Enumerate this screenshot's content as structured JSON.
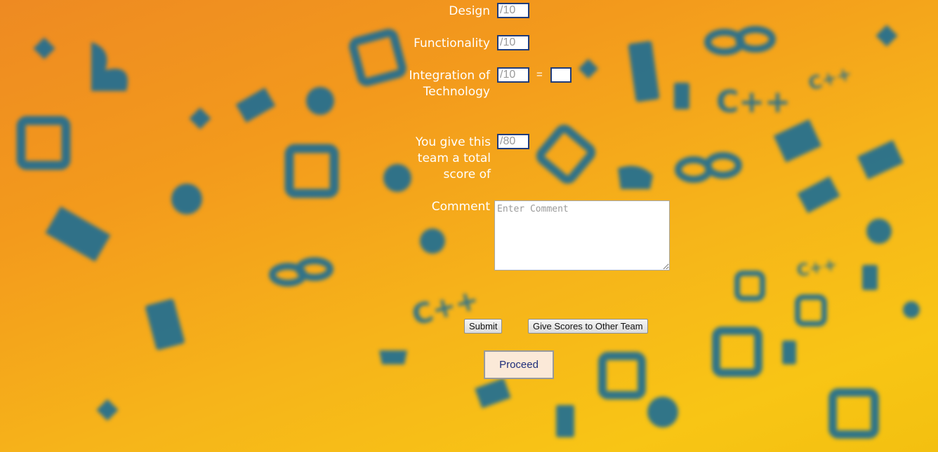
{
  "colors": {
    "accent_blue": "#1f3b7a",
    "pattern_blue": "#1a6c96",
    "bg_orange": "#f39a1c",
    "bg_yellow": "#f8c515"
  },
  "scores": {
    "design": {
      "label": "Design",
      "placeholder": "/10"
    },
    "functionality": {
      "label": "Functionality",
      "placeholder": "/10"
    },
    "integration": {
      "label_line1": "Integration of",
      "label_line2": "Technology",
      "placeholder": "/10",
      "equals": "="
    },
    "total": {
      "label_line1": "You give this",
      "label_line2": "team a total",
      "label_line3": "score of",
      "placeholder": "/80"
    }
  },
  "comment": {
    "label": "Comment",
    "placeholder": "Enter Comment"
  },
  "buttons": {
    "submit": "Submit",
    "other_team": "Give Scores to Other Team",
    "proceed": "Proceed"
  }
}
